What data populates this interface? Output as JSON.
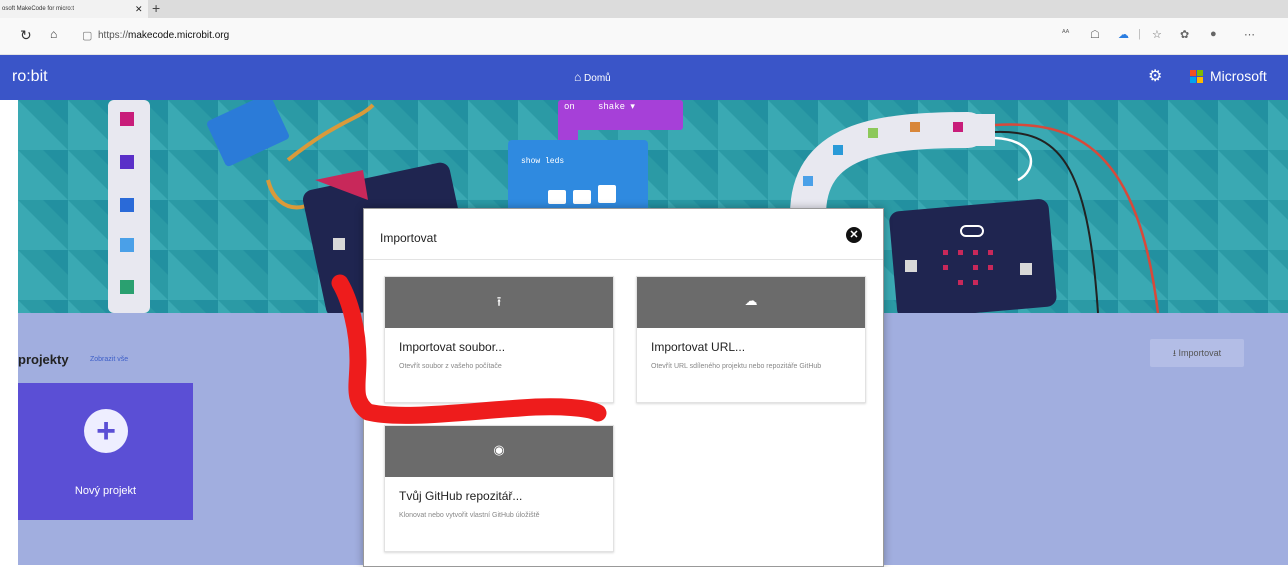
{
  "browser": {
    "tab_title": "osoft MakeCode for micro:t",
    "tab_close": "✕",
    "new_tab": "+",
    "url_prefix": "https://",
    "url_host": "makecode.microbit.org"
  },
  "app": {
    "brand": "ro:bit",
    "home_label": "Domů",
    "ms_label": "Microsoft",
    "ms_colors": [
      "#f25022",
      "#7fba00",
      "#00a4ef",
      "#ffb900"
    ]
  },
  "hero": {
    "block_event": "on",
    "block_event_value": "shake ▾",
    "block_show": "show leds"
  },
  "projects": {
    "title": "projekty",
    "view_all": "Zobrazit vše",
    "new_project": "Nový projekt",
    "import_button": "⭳ Importovat"
  },
  "modal": {
    "title": "Importovat",
    "close": "✕",
    "cards": [
      {
        "icon": "upload-icon",
        "title": "Importovat soubor...",
        "desc": "Otevřít soubor z vašeho počítače"
      },
      {
        "icon": "cloud-upload-icon",
        "title": "Importovat URL...",
        "desc": "Otevřít URL sdíleného projektu nebo repozitáře GitHub"
      },
      {
        "icon": "github-icon",
        "title": "Tvůj GitHub repozitář...",
        "desc": "Klonovat nebo vytvořit vlastní GitHub úložiště"
      }
    ]
  },
  "colors": {
    "header": "#3a55c8",
    "hero": "#2b9aa5",
    "new_project_tile": "#5b4fd5",
    "annotation": "#ee1c1c"
  }
}
